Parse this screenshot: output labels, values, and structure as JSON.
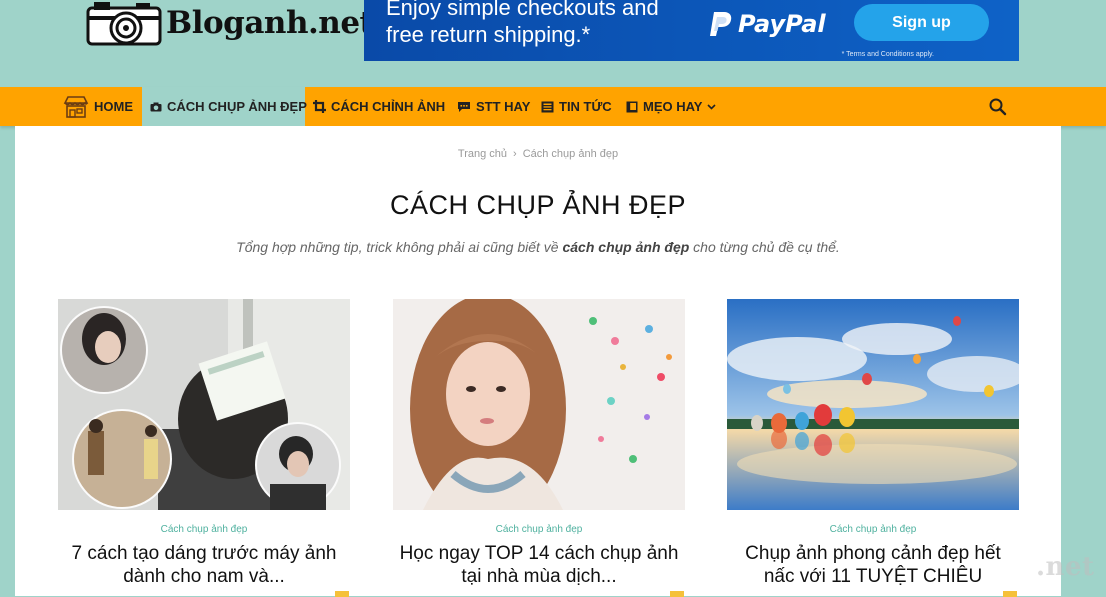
{
  "header": {
    "logo_text": "Bloganh.net"
  },
  "ad": {
    "line1": "Enjoy simple checkouts and",
    "line2": "free return shipping.*",
    "brand": "PayPal",
    "button": "Sign up",
    "terms": "* Terms and Conditions apply.",
    "colors": {
      "background": "#0e62c7",
      "button": "#24a3ea"
    }
  },
  "nav": {
    "items": [
      {
        "label": "HOME",
        "icon": "storefront-icon"
      },
      {
        "label": "CÁCH CHỤP ẢNH ĐẸP",
        "icon": "camera-icon"
      },
      {
        "label": "CÁCH CHỈNH ẢNH",
        "icon": "crop-icon"
      },
      {
        "label": "STT HAY",
        "icon": "chat-bubble-icon"
      },
      {
        "label": "TIN TỨC",
        "icon": "newspaper-icon"
      },
      {
        "label": "MẸO HAY",
        "icon": "book-icon"
      }
    ],
    "active_index": 1,
    "colors": {
      "bar": "#ffa300",
      "active": "#9fd3c9"
    }
  },
  "breadcrumb": {
    "home": "Trang chủ",
    "separator": "›",
    "current": "Cách chụp ảnh đẹp"
  },
  "page": {
    "title": "CÁCH CHỤP ẢNH ĐẸP",
    "desc_before": "Tổng hợp những tip, trick không phải ai cũng biết về ",
    "desc_bold": "cách chụp ảnh đẹp",
    "desc_after": " cho từng chủ đề cụ thể."
  },
  "posts": [
    {
      "category": "Cách chụp ảnh đẹp",
      "title_line1": "7 cách tạo dáng trước máy ảnh",
      "title_line2": "dành cho nam và..."
    },
    {
      "category": "Cách chụp ảnh đẹp",
      "title_line1": "Học ngay TOP 14 cách chụp ảnh",
      "title_line2": "tại nhà mùa dịch..."
    },
    {
      "category": "Cách chụp ảnh đẹp",
      "title_line1": "Chụp ảnh phong cảnh đẹp hết",
      "title_line2": "nấc với 11 TUYỆT CHIÊU"
    }
  ],
  "watermark": ".net"
}
